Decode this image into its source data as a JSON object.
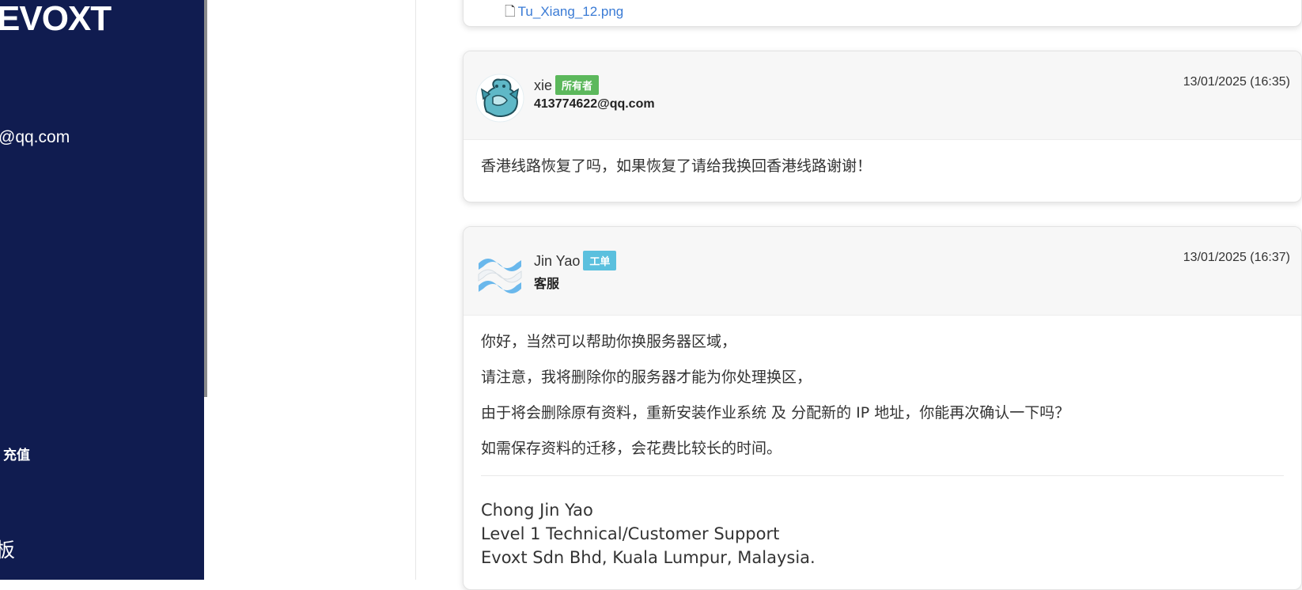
{
  "sidebar": {
    "brand": "EVOXT",
    "email": "@qq.com",
    "recharge": "充值",
    "panel": "板"
  },
  "attachment": {
    "filename": "Tu_Xiang_12.png",
    "icon": "file-icon"
  },
  "replies": [
    {
      "author": "xie",
      "badge": "所有者",
      "badge_color": "#5cb85c",
      "sub": "413774622@qq.com",
      "date": "13/01/2025 (16:35)",
      "message": "香港线路恢复了吗，如果恢复了请给我换回香港线路谢谢！"
    },
    {
      "author": "Jin Yao",
      "badge": "工单",
      "badge_color": "#5bc0de",
      "sub": "客服",
      "date": "13/01/2025 (16:37)",
      "lines": [
        "你好，当然可以帮助你换服务器区域，",
        "请注意，我将删除你的服务器才能为你处理换区，",
        "由于将会删除原有资料，重新安装作业系统 及 分配新的 IP 地址，你能再次确认一下吗？",
        "如需保存资料的迁移，会花费比较长的时间。"
      ],
      "signature": [
        "Chong Jin Yao",
        "Level 1 Technical/Customer Support",
        "Evoxt Sdn Bhd, Kuala Lumpur, Malaysia."
      ]
    }
  ]
}
